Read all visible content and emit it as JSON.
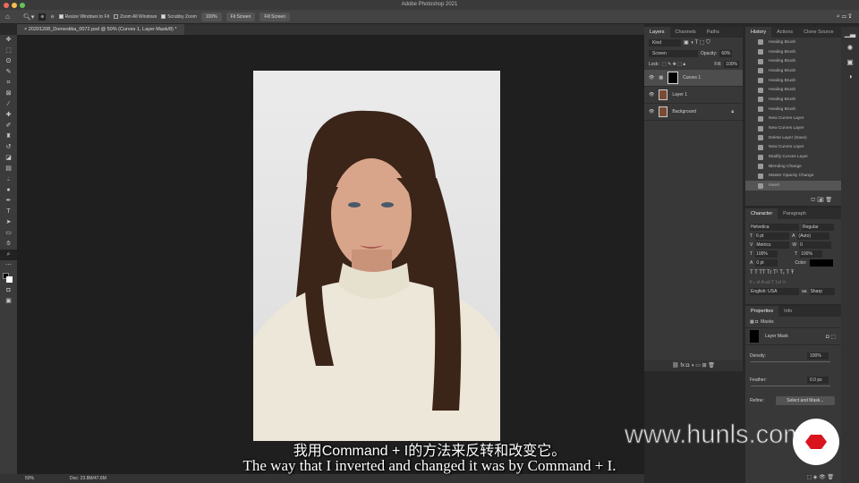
{
  "app": {
    "title": "Adobe Photoshop 2021"
  },
  "options": {
    "resize": "Resize Windows to Fit",
    "zoom_all": "Zoom All Windows",
    "scrubby": "Scrubby Zoom",
    "zoom_value": "100%",
    "fit_screen": "Fit Screen",
    "fill_screen": "Fill Screen"
  },
  "document": {
    "tab": "20201208_Domestika_0072.psd @ 50% (Curves 1, Layer Mask/8) *",
    "zoom": "50%",
    "doc_size": "Doc: 23.8M/47.6M"
  },
  "layers": {
    "tabs": [
      "Layers",
      "Channels",
      "Paths"
    ],
    "kind": "Kind",
    "blend": "Screen",
    "opacity_label": "Opacity:",
    "opacity": "60%",
    "lock_label": "Lock:",
    "fill_label": "Fill:",
    "fill": "100%",
    "items": [
      {
        "name": "Curves 1"
      },
      {
        "name": "Layer 1"
      },
      {
        "name": "Background"
      }
    ]
  },
  "history": {
    "tabs": [
      "History",
      "Actions",
      "Clone Source"
    ],
    "items": [
      "Healing Brush",
      "Healing Brush",
      "Healing Brush",
      "Healing Brush",
      "Healing Brush",
      "Healing Brush",
      "Healing Brush",
      "Healing Brush",
      "New Curves Layer",
      "New Curves Layer",
      "Delete Layer (Save)",
      "New Curves Layer",
      "Modify Curves Layer",
      "Blending Change",
      "Master Opacity Change",
      "Invert"
    ]
  },
  "character": {
    "tabs": [
      "Character",
      "Paragraph"
    ],
    "font": "Helvetica",
    "style": "Regular",
    "size": "6 pt",
    "leading": "(Auto)",
    "kerning": "Metrics",
    "tracking": "0",
    "vscale": "100%",
    "hscale": "100%",
    "baseline": "0 pt",
    "color_label": "Color:",
    "language": "English: USA",
    "aa": "Sharp"
  },
  "properties": {
    "tabs": [
      "Properties",
      "Info"
    ],
    "masks": "Masks",
    "layer_mask": "Layer Mask",
    "density_label": "Density:",
    "density": "100%",
    "feather_label": "Feather:",
    "feather": "0.0 px",
    "refine_label": "Refine:",
    "select_mask": "Select and Mask..."
  },
  "subtitles": {
    "zh": "我用Command + I的方法来反转和改变它。",
    "en": "The way that I inverted and changed it was by Command + I."
  },
  "watermark": "www.hunls.com"
}
